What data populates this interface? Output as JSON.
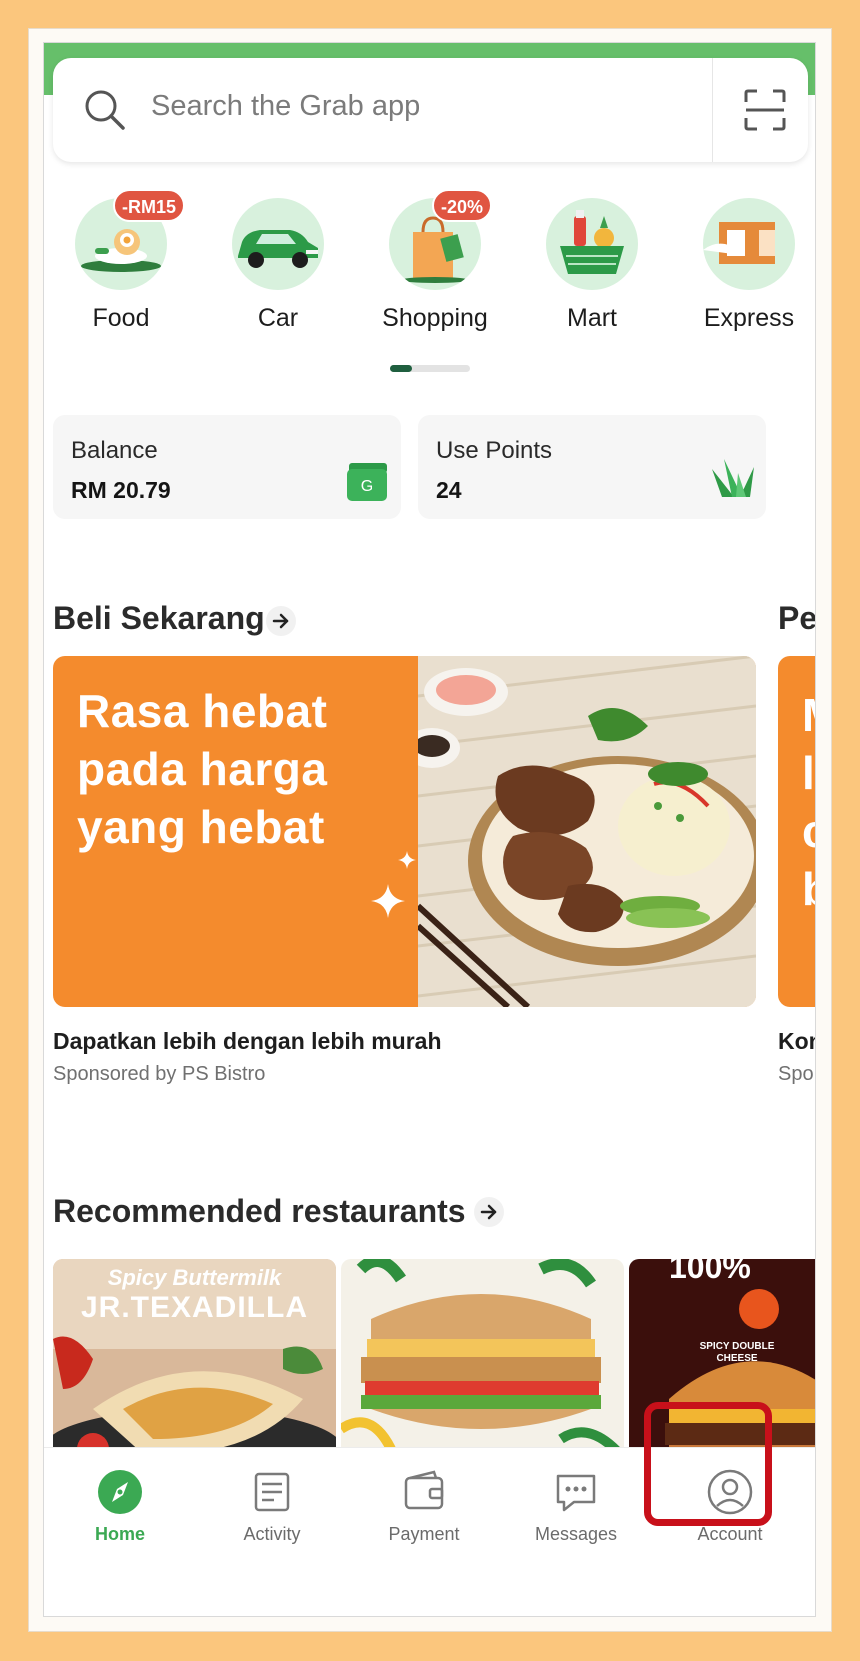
{
  "search": {
    "placeholder": "Search the Grab app"
  },
  "services": [
    {
      "label": "Food",
      "badge": "-RM15"
    },
    {
      "label": "Car",
      "badge": ""
    },
    {
      "label": "Shopping",
      "badge": "-20%"
    },
    {
      "label": "Mart",
      "badge": ""
    },
    {
      "label": "Express",
      "badge": ""
    }
  ],
  "wallet": {
    "balance_label": "Balance",
    "balance_value": "RM 20.79",
    "points_label": "Use Points",
    "points_value": "24"
  },
  "sections": {
    "buy_now": "Beli Sekarang",
    "next_peek": "Pe",
    "recommended": "Recommended restaurants"
  },
  "promo": {
    "headline_1": "Rasa hebat",
    "headline_2": "pada harga",
    "headline_3": "yang hebat",
    "title": "Dapatkan lebih dengan lebih murah",
    "sponsor": "Sponsored by PS Bistro",
    "next_title_peek": "Kon",
    "next_sponsor_peek": "Spo",
    "next_letters": [
      "M",
      "l",
      "c",
      "b"
    ]
  },
  "restaurants": [
    {
      "caption_1": "Spicy Buttermilk",
      "caption_2": "JR.TEXADILLA"
    },
    {
      "caption_1": "",
      "caption_2": ""
    },
    {
      "caption_1": "100%",
      "caption_2": "SPICY DOUBLE CHEESE"
    }
  ],
  "nav": [
    {
      "label": "Home",
      "icon": "compass-icon",
      "active": true
    },
    {
      "label": "Activity",
      "icon": "receipt-icon",
      "active": false
    },
    {
      "label": "Payment",
      "icon": "wallet-icon",
      "active": false
    },
    {
      "label": "Messages",
      "icon": "chat-icon",
      "active": false
    },
    {
      "label": "Account",
      "icon": "user-circle-icon",
      "active": false
    }
  ],
  "colors": {
    "brand_green": "#3ba953",
    "promo_orange": "#f48b2d",
    "badge_red": "#e05541",
    "highlight_red": "#c8101a"
  }
}
